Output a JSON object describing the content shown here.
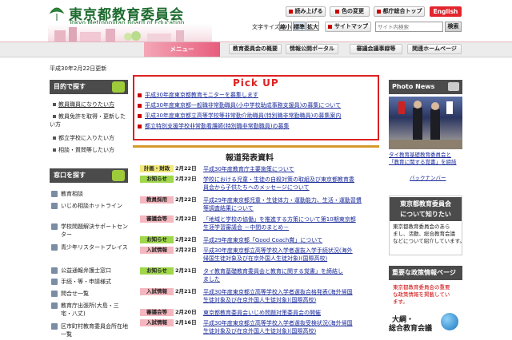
{
  "header": {
    "org_jp": "東京都教育委員会",
    "org_en": "Tokyo Metropolitan Board of Education",
    "read_aloud": "読み上げる",
    "color_change": "色の変更",
    "metro_top": "都庁総合トップ",
    "english": "English",
    "font_size_label": "文字サイズ",
    "font_small": "縮小",
    "font_standard": "標準",
    "font_large": "拡大",
    "sitemap": "サイトマップ",
    "search_placeholder": "サイト内検索",
    "search_button": "検索"
  },
  "nav": {
    "menu": "メニュー",
    "items": [
      "教育委員会の概要",
      "情報公開ポータル",
      "審議会議事録等",
      "関連ホームページ"
    ]
  },
  "updated": "平成30年2月22日更新",
  "sidebar": {
    "purpose_title": "目的で探す",
    "purpose_items": [
      "教員職員になりたい方",
      "教員免許を取得・更新したい方",
      "都立学校に入りたい方",
      "相談・質問等したい方"
    ],
    "window_title": "窓口を探す",
    "window_items": [
      "教育相談",
      "いじめ相談ホットライン",
      "学校問題解決サポートセンター",
      "青少年リスタートプレイス",
      "公益通報弁護士窓口",
      "手続・等・申請様式",
      "問合せ一覧",
      "教育庁出張所(大島・三宅・八丈)",
      "区市町村教育委員会所在地一覧"
    ]
  },
  "pickup": {
    "title": "Pick UP",
    "items": [
      "平成30年度東京都教育モニターを募集します",
      "平成30年度東京都一般職非常勤職員(小中学校助成事務支援員)の募集について",
      "平成30年度東京都立高等学校等非常勤介助職員(特別職非常勤職員)の募集案内",
      "都立特別支援学校非常勤看護師(特別職非常勤職員)の募集"
    ]
  },
  "press": {
    "title": "報道発表資料",
    "rows": [
      {
        "tag": "計画・財政",
        "tag_bg": "#f2e87a",
        "date": "2月22日",
        "text": "平成30年度教育庁主要施策について",
        "text2": ""
      },
      {
        "tag": "お知らせ",
        "tag_bg": "#9fd64a",
        "date": "2月22日",
        "text": "学校における児童・生徒の自殺対策の取組及び東京都教育委",
        "text2": "員会から子供たちへのメッセージについて"
      },
      {
        "tag": "教員採用",
        "tag_bg": "#f4b7bf",
        "date": "2月22日",
        "text": "平成29年度東京都児童・生徒体力・運動能力、生活・運動習慣",
        "text2": "等調査結果について"
      },
      {
        "tag": "審議会等",
        "tag_bg": "#f4b7bf",
        "date": "2月22日",
        "text": "「地域と学校の協働」を推進する方策について第10期東京都",
        "text2": "生涯学習審議会 －中間のまとめ－"
      },
      {
        "tag": "お知らせ",
        "tag_bg": "#9fd64a",
        "date": "2月22日",
        "text": "平成29年度東京都「Good Coach賞」について",
        "text2": ""
      },
      {
        "tag": "入試情報",
        "tag_bg": "#f4b7bf",
        "date": "2月22日",
        "text": "平成30年度東京都立高等学校入学者選抜入学手続状況(海外",
        "text2": "帰国生徒対象及び在京外国人生徒対象)(国際高校)"
      },
      {
        "tag": "お知らせ",
        "tag_bg": "#9fd64a",
        "date": "2月21日",
        "text": "タイ教育基礎教育委員会と教育に関する覚書」を締結し",
        "text2": "ました"
      },
      {
        "tag": "入試情報",
        "tag_bg": "#f4b7bf",
        "date": "2月21日",
        "text": "平成30年度東京都立高等学校入学者選抜合格発表(海外帰国",
        "text2": "生徒対象及び在京外国人生徒対象)(国際高校)"
      },
      {
        "tag": "審議会等",
        "tag_bg": "#f4b7bf",
        "date": "2月20日",
        "text": "東京都教育委員会いじめ問題対策委員会の開催",
        "text2": ""
      },
      {
        "tag": "入試情報",
        "tag_bg": "#f4b7bf",
        "date": "2月16日",
        "text": "平成30年度東京都立高等学校入学者選抜受検状況(海外帰国",
        "text2": "生徒対象及び在京外国人生徒対象)(国際高校)"
      }
    ]
  },
  "right": {
    "photo_title": "Photo News",
    "photo_caption1": "タイ教育基礎教育委員会と",
    "photo_caption2": "「教育に関する覚書」を締結",
    "backnumber": "バックナンバー",
    "board_title1": "東京都教育委員会",
    "board_title2": "について知りたい",
    "board_desc": [
      "東京都教育委員会のあら",
      "まし、活動、総合教育会議",
      "などについて紹介しています。"
    ],
    "policy_title": "重要な政策情報ページ",
    "policy_desc": [
      "東京都教育委員会の重要",
      "な政策情報を掲載してい",
      "ます。"
    ],
    "mayor_label": "大綱・",
    "council_label": "総合教育会議"
  },
  "colors": {
    "accent_red": "#e2262d",
    "brand_green": "#1d6b2f",
    "pickup_border": "#dd2222",
    "press_border": "#d69a2a"
  }
}
